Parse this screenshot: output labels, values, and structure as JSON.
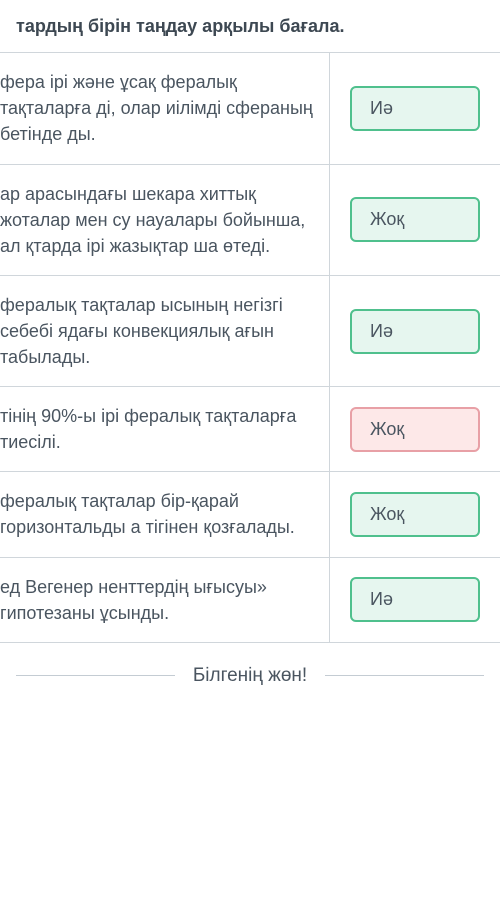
{
  "header": {
    "title": "тардың бірін таңдау арқылы бағала."
  },
  "rows": [
    {
      "text": "фера ірі және ұсақ фералық тақталарға ді, олар иілімді сфераның бетінде ды.",
      "answer": "Иә",
      "state": "green"
    },
    {
      "text": "ар арасындағы шекара хиттық жоталар мен су науалары бойынша, ал қтарда ірі жазықтар ша өтеді.",
      "answer": "Жоқ",
      "state": "green"
    },
    {
      "text": "фералық тақталар ысының негізгі себебі ядағы конвекциялық ағын табылады.",
      "answer": "Иә",
      "state": "green"
    },
    {
      "text": "тінің 90%-ы ірі фералық тақталарға тиесілі.",
      "answer": "Жоқ",
      "state": "red"
    },
    {
      "text": "фералық тақталар бір-қарай горизонтальды а тігінен қозғалады.",
      "answer": "Жоқ",
      "state": "green"
    },
    {
      "text": "ед Вегенер ненттердің ығысуы» гипотезаны ұсынды.",
      "answer": "Иә",
      "state": "green"
    }
  ],
  "footer": {
    "label": "Білгенің жөн!"
  }
}
